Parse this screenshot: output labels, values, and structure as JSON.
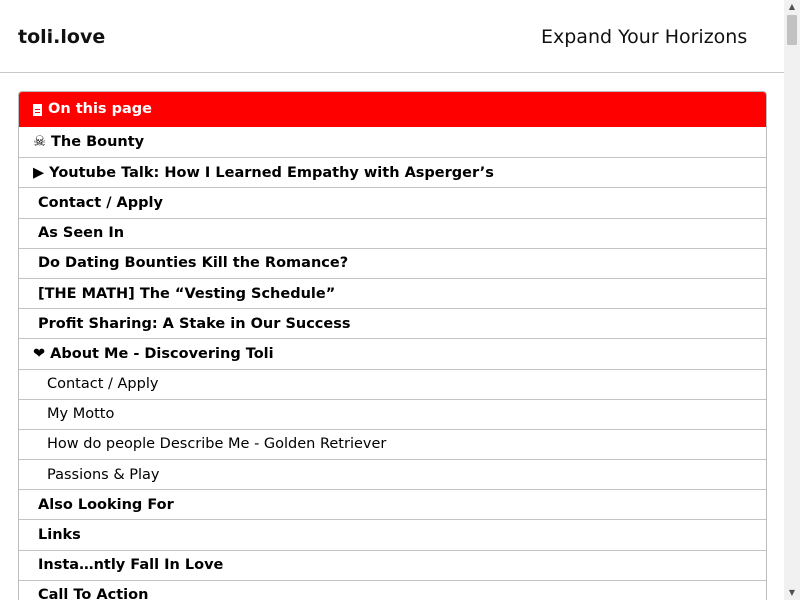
{
  "header": {
    "brand": "toli.love",
    "icon_glyph": "",
    "menu_glyph": "",
    "menu_label": "Expand Your Horizons"
  },
  "toc": {
    "title": "On this page",
    "items": [
      {
        "glyph": "☠",
        "label": "The Bounty",
        "level": "top"
      },
      {
        "glyph": "▶",
        "label": "Youtube Talk: How I Learned Empathy with Asperger’s",
        "level": "top"
      },
      {
        "glyph": "",
        "label": "Contact / Apply",
        "level": "top"
      },
      {
        "glyph": "",
        "label": "As Seen In",
        "level": "top"
      },
      {
        "glyph": "",
        "label": "Do Dating Bounties Kill the Romance?",
        "level": "top"
      },
      {
        "glyph": "",
        "label": "[THE MATH] The “Vesting Schedule”",
        "level": "top"
      },
      {
        "glyph": "",
        "label": "Profit Sharing: A Stake in Our Success",
        "level": "top"
      },
      {
        "glyph": "❤",
        "label": "About Me - Discovering Toli",
        "level": "top"
      },
      {
        "glyph": "",
        "label": "Contact / Apply",
        "level": "sub"
      },
      {
        "glyph": "",
        "label": "My Motto",
        "level": "sub"
      },
      {
        "glyph": "",
        "label": "How do people Describe Me - Golden Retriever",
        "level": "sub"
      },
      {
        "glyph": "",
        "label": "Passions & Play",
        "level": "sub"
      },
      {
        "glyph": "",
        "label": "Also Looking For",
        "level": "top"
      },
      {
        "glyph": "",
        "label": "Links",
        "level": "top"
      },
      {
        "glyph": "",
        "label": "Insta…ntly Fall In Love",
        "level": "top"
      },
      {
        "glyph": "",
        "label": "Call To Action",
        "level": "top"
      }
    ]
  },
  "scrollbar": {
    "up_glyph": "▲",
    "down_glyph": "▼"
  },
  "colors": {
    "toc_header_bg": "#ff0000",
    "border": "#c4c4c4"
  }
}
